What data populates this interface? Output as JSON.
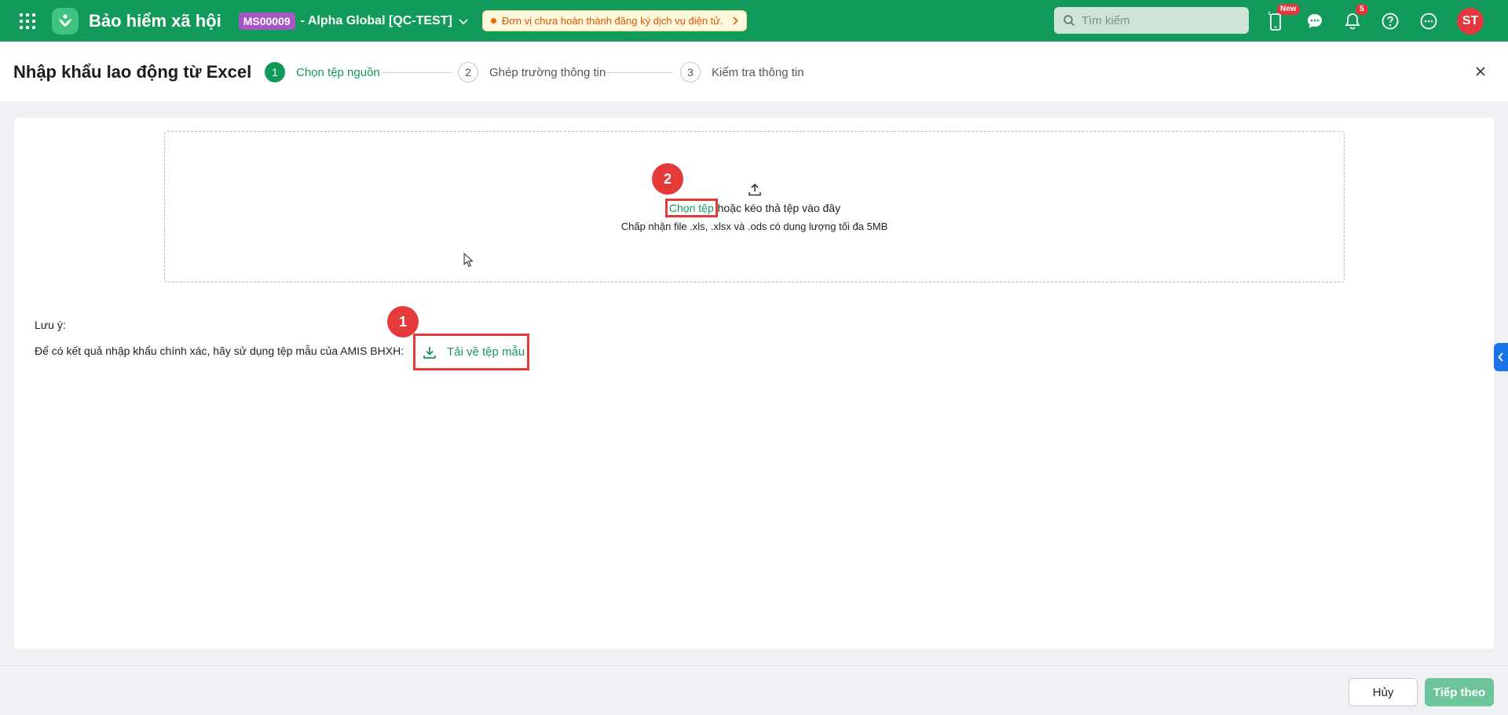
{
  "topbar": {
    "app_title": "Bảo hiểm xã hội",
    "org_code": "MS00009",
    "org_name": "- Alpha Global [QC-TEST]",
    "notice": "Đơn vị chưa hoàn thành đăng ký dịch vụ điện tử.",
    "search_placeholder": "Tìm kiếm",
    "mobile_badge": "New",
    "notification_count": "5",
    "avatar_initials": "ST",
    "colors": {
      "brand": "#129a5a",
      "badge": "#e8333a",
      "org_code_bg": "#a855c6",
      "avatar_bg": "#e5373f"
    }
  },
  "header": {
    "title": "Nhập khẩu lao động từ Excel",
    "steps": [
      {
        "num": "1",
        "label": "Chọn tệp nguồn",
        "state": "active"
      },
      {
        "num": "2",
        "label": "Ghép trường thông tin",
        "state": "inactive"
      },
      {
        "num": "3",
        "label": "Kiểm tra thông tin",
        "state": "inactive"
      }
    ]
  },
  "dropzone": {
    "choose_link": "Chọn tệp",
    "drag_text": " hoặc kéo thả tệp vào đây",
    "accept_text": "Chấp nhận file .xls, .xlsx và .ods có dung lượng tối đa 5MB"
  },
  "note": {
    "title": "Lưu ý:",
    "text": "Để có kết quả nhập khẩu chính xác, hãy sử dụng tệp mẫu của AMIS BHXH:",
    "download_label": "Tải về tệp mẫu"
  },
  "markers": {
    "download": "1",
    "choose_file": "2"
  },
  "footer": {
    "cancel_label": "Hủy",
    "next_label": "Tiếp theo"
  }
}
